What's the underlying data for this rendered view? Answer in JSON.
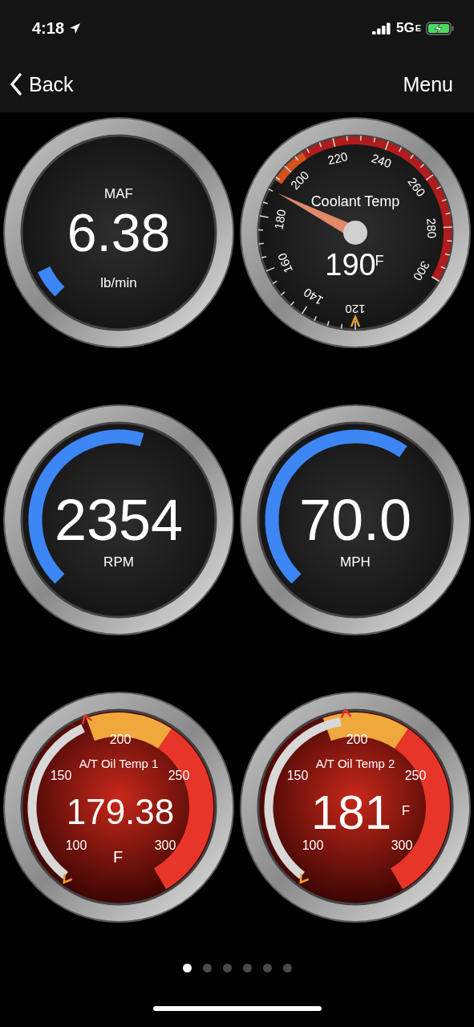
{
  "status_bar": {
    "time": "4:18",
    "network": "5G",
    "network_suffix": "E",
    "charging": true
  },
  "nav": {
    "back": "Back",
    "menu": "Menu"
  },
  "gauges": [
    {
      "kind": "arc",
      "title": "MAF",
      "value": "6.38",
      "unit": "lb/min"
    },
    {
      "kind": "dial",
      "title": "Coolant Temp",
      "value": "190",
      "unit": "F",
      "scale": [
        "120",
        "140",
        "160",
        "180",
        "200",
        "220",
        "240",
        "260",
        "280",
        "300"
      ]
    },
    {
      "kind": "arc",
      "value": "2354",
      "unit": "RPM"
    },
    {
      "kind": "arc",
      "value": "70.0",
      "unit": "MPH"
    },
    {
      "kind": "oil",
      "title": "A/T Oil Temp 1",
      "value": "179.38",
      "unit": "F",
      "scale": [
        "100",
        "150",
        "200",
        "250",
        "300"
      ]
    },
    {
      "kind": "oil-inline",
      "title": "A/T Oil Temp 2",
      "value": "181",
      "unit": "F",
      "scale": [
        "100",
        "150",
        "200",
        "250",
        "300"
      ]
    }
  ],
  "pages": [
    {
      "selected": true
    },
    {
      "selected": false
    },
    {
      "selected": false
    },
    {
      "selected": false
    },
    {
      "selected": false
    },
    {
      "selected": false
    }
  ]
}
